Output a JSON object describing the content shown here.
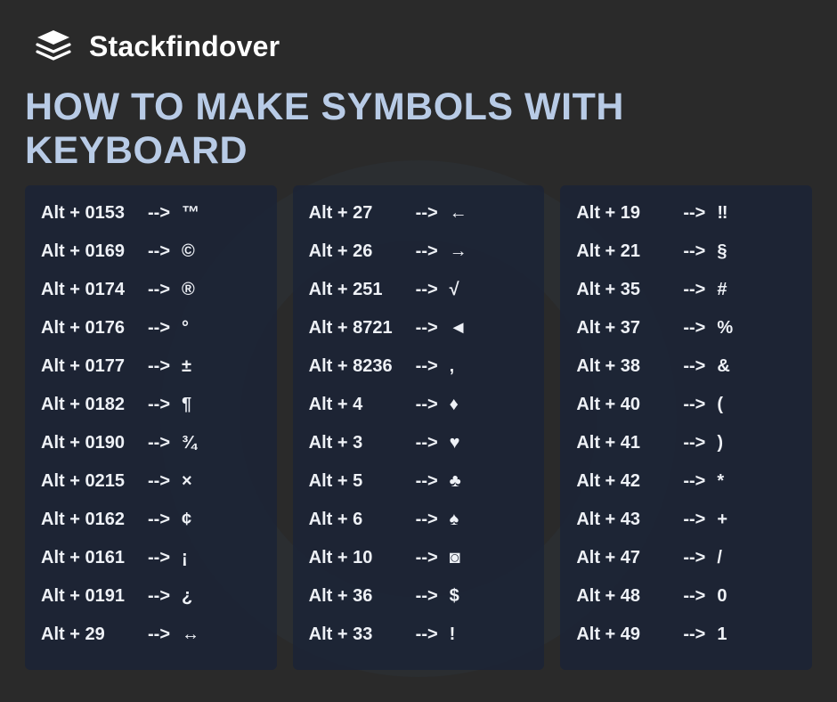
{
  "brand": "Stackfindover",
  "title": "HOW TO MAKE SYMBOLS WITH KEYBOARD",
  "arrow_text": "-->",
  "columns": [
    [
      {
        "key": "Alt + 0153",
        "symbol": "™"
      },
      {
        "key": "Alt + 0169",
        "symbol": "©"
      },
      {
        "key": "Alt + 0174",
        "symbol": "®"
      },
      {
        "key": "Alt + 0176",
        "symbol": "°"
      },
      {
        "key": "Alt + 0177",
        "symbol": "±"
      },
      {
        "key": "Alt + 0182",
        "symbol": "¶"
      },
      {
        "key": "Alt + 0190",
        "symbol": "¾"
      },
      {
        "key": "Alt + 0215",
        "symbol": "×"
      },
      {
        "key": "Alt + 0162",
        "symbol": "¢"
      },
      {
        "key": "Alt + 0161",
        "symbol": "¡"
      },
      {
        "key": "Alt + 0191",
        "symbol": "¿"
      },
      {
        "key": "Alt + 29",
        "symbol": "↔"
      }
    ],
    [
      {
        "key": "Alt + 27",
        "symbol": "←"
      },
      {
        "key": "Alt + 26",
        "symbol": "→"
      },
      {
        "key": "Alt + 251",
        "symbol": "√"
      },
      {
        "key": "Alt + 8721",
        "symbol": "◄"
      },
      {
        "key": "Alt + 8236",
        "symbol": ","
      },
      {
        "key": "Alt + 4",
        "symbol": "♦"
      },
      {
        "key": "Alt + 3",
        "symbol": "♥"
      },
      {
        "key": "Alt + 5",
        "symbol": "♣"
      },
      {
        "key": "Alt + 6",
        "symbol": "♠"
      },
      {
        "key": "Alt + 10",
        "symbol": "◙"
      },
      {
        "key": "Alt + 36",
        "symbol": "$"
      },
      {
        "key": "Alt + 33",
        "symbol": "!"
      }
    ],
    [
      {
        "key": "Alt + 19",
        "symbol": "‼"
      },
      {
        "key": "Alt + 21",
        "symbol": "§"
      },
      {
        "key": "Alt + 35",
        "symbol": "#"
      },
      {
        "key": "Alt + 37",
        "symbol": "%"
      },
      {
        "key": "Alt + 38",
        "symbol": "&"
      },
      {
        "key": "Alt + 40",
        "symbol": "("
      },
      {
        "key": "Alt + 41",
        "symbol": ")"
      },
      {
        "key": "Alt + 42",
        "symbol": "*"
      },
      {
        "key": "Alt + 43",
        "symbol": "+"
      },
      {
        "key": "Alt + 47",
        "symbol": "/"
      },
      {
        "key": "Alt + 48",
        "symbol": "0"
      },
      {
        "key": "Alt + 49",
        "symbol": "1"
      }
    ]
  ]
}
